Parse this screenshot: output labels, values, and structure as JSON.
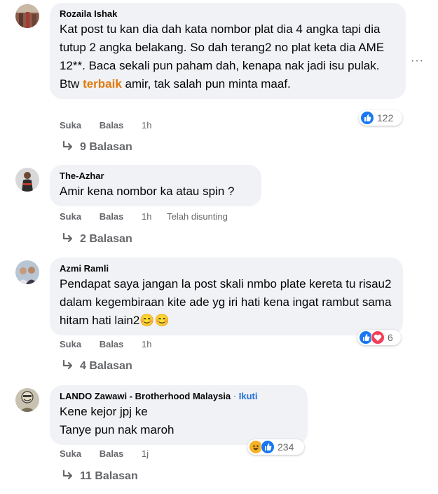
{
  "comments": [
    {
      "author": "Rozaila Ishak",
      "text_before": "Kat post tu kan dia dah kata nombor plat dia 4 angka tapi dia tutup 2 angka belakang. So dah terang2 no plat keta dia AME 12**. Baca sekali pun paham dah, kenapa nak jadi isu pulak. Btw ",
      "highlight": "terbaik",
      "text_after": " amir, tak salah pun minta maaf.",
      "like": "Suka",
      "reply": "Balas",
      "time": "1h",
      "reactions": "122",
      "replies": "9 Balasan",
      "more": "···"
    },
    {
      "author": "The-Azhar",
      "text": "Amir kena nombor ka atau spin ?",
      "like": "Suka",
      "reply": "Balas",
      "time": "1h",
      "edited": "Telah disunting",
      "replies": "2 Balasan"
    },
    {
      "author": "Azmi Ramli",
      "text": "Pendapat saya jangan la post skali nmbo plate kereta tu risau2 dalam kegembiraan kite ade yg iri hati kena ingat rambut sama hitam hati lain2😊😊",
      "like": "Suka",
      "reply": "Balas",
      "time": "1h",
      "reactions": "6",
      "replies": "4 Balasan"
    },
    {
      "author": "LANDO Zawawi - Brotherhood Malaysia",
      "separator": "·",
      "follow": "Ikuti",
      "line1": "Kene kejor jpj ke",
      "line2": "Tanye pun nak maroh",
      "like": "Suka",
      "reply": "Balas",
      "time": "1j",
      "reactions": "234",
      "replies": "11 Balasan"
    }
  ],
  "colors": {
    "bubble": "#f0f2f5",
    "like_blue": "#1877f2",
    "love_red": "#f33e58",
    "haha_yellow": "#f7b125",
    "follow_blue": "#216fdb"
  }
}
